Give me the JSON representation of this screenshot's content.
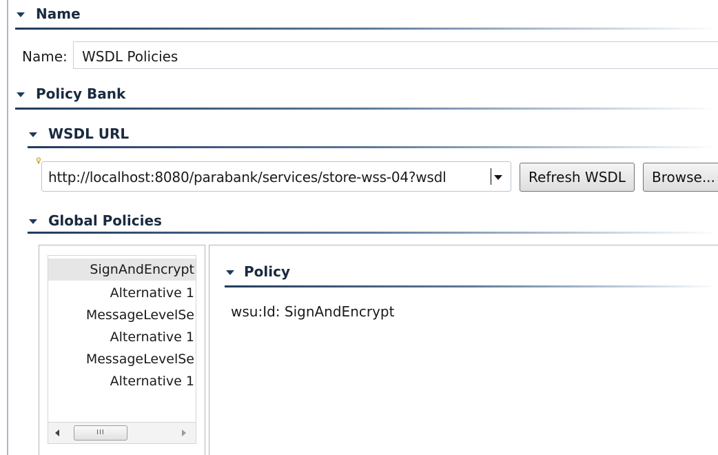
{
  "sections": {
    "name": "Name",
    "policy_bank": "Policy Bank",
    "wsdl_url": "WSDL URL",
    "global_policies": "Global Policies",
    "policy": "Policy"
  },
  "name_field": {
    "label": "Name:",
    "value": "WSDL Policies"
  },
  "wsdl": {
    "url_value": "http://localhost:8080/parabank/services/store-wss-04?wsdl",
    "refresh_label": "Refresh WSDL",
    "browse_label": "Browse..."
  },
  "tree": {
    "items": [
      {
        "label": "SignAndEncrypt",
        "selected": true
      },
      {
        "label": "Alternative 1"
      },
      {
        "label": "MessageLevelSe"
      },
      {
        "label": "Alternative 1"
      },
      {
        "label": "MessageLevelSe"
      },
      {
        "label": "Alternative 1"
      }
    ],
    "scroll_grip": "III"
  },
  "policy": {
    "id_text": "wsu:Id: SignAndEncrypt"
  },
  "colors": {
    "header_rule": "#1f3b5c",
    "header_text": "#1a2a40",
    "selection": "#e6e6e6",
    "panel_border": "#b4b4b4"
  },
  "icons": [
    "section-collapse-triangle-icon",
    "lightbulb-icon",
    "dropdown-arrow-icon",
    "scroll-left-arrow-icon",
    "scroll-right-arrow-icon"
  ]
}
